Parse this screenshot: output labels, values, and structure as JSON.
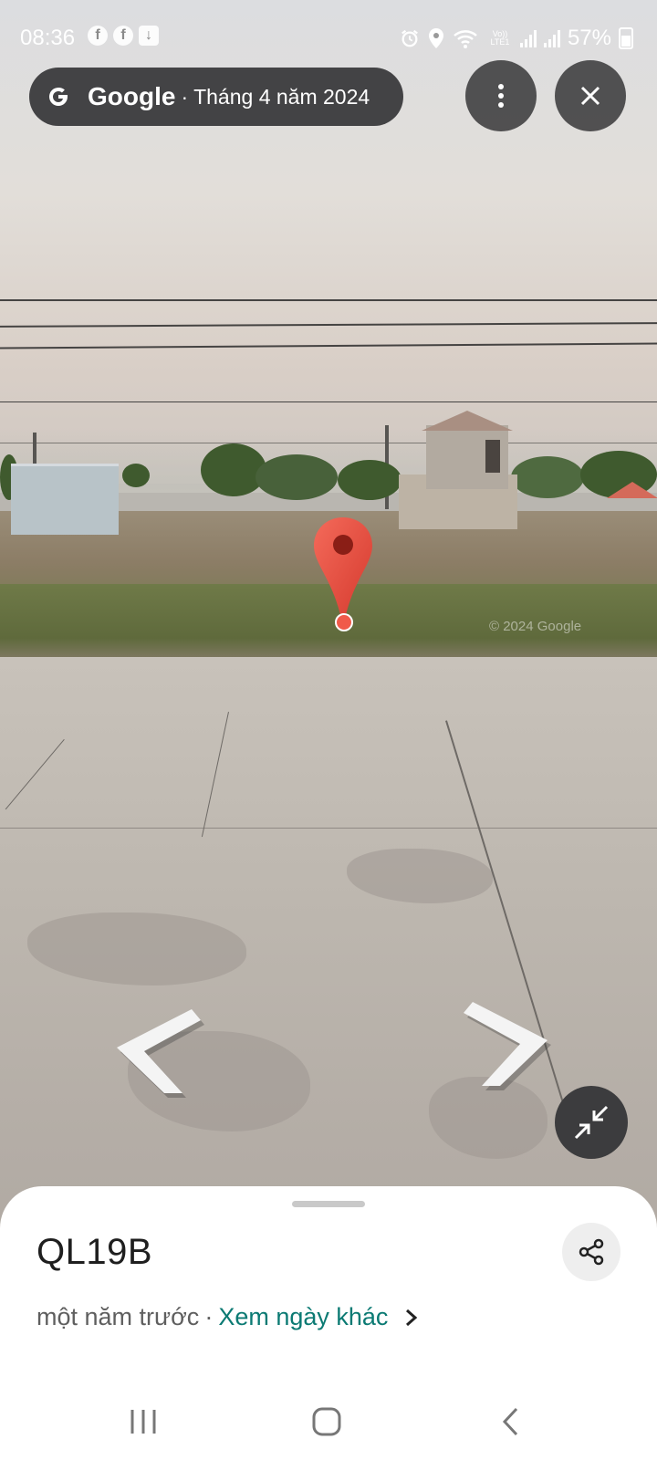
{
  "status_bar": {
    "time": "08:36",
    "notification_icons": [
      "facebook-icon",
      "facebook-icon",
      "download-icon"
    ],
    "right_icons": [
      "alarm-icon",
      "location-icon",
      "wifi-icon",
      "volte-icon",
      "signal-icon",
      "signal-icon"
    ],
    "volte_label": "Vo)) LTE1",
    "battery": "57%"
  },
  "top_bar": {
    "brand": "Google",
    "date": "· Tháng 4 năm 2024"
  },
  "street_view": {
    "watermark": "© 2024 Google",
    "marker_color": "#e8483c"
  },
  "place": {
    "title": "QL19B",
    "age": "một năm trước",
    "separator": "·",
    "other_dates_link": "Xem ngày khác"
  },
  "colors": {
    "link": "#0b7a73",
    "overlay": "#3c3c3e"
  }
}
